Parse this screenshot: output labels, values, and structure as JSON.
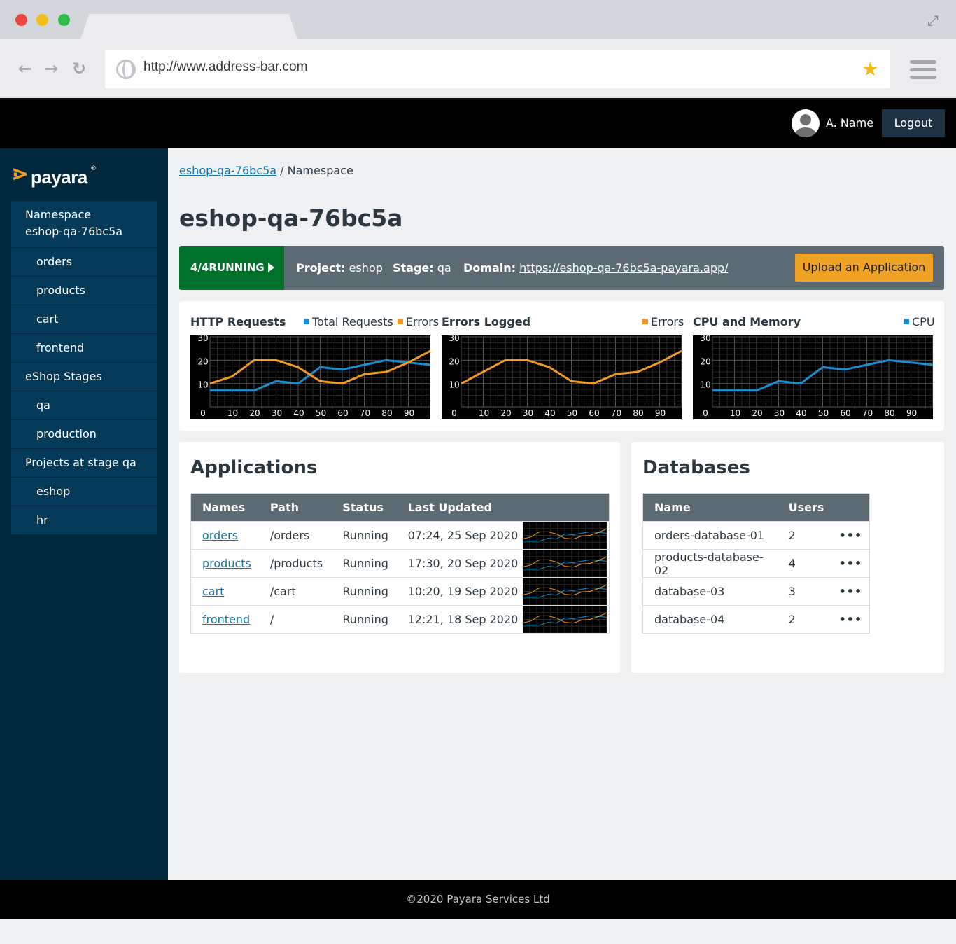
{
  "browser": {
    "url": "http://www.address-bar.com",
    "back_icon": "arrow-left-icon",
    "forward_icon": "arrow-right-icon",
    "reload_icon": "reload-icon",
    "bookmark_icon": "star-icon",
    "menu_icon": "hamburger-menu-icon"
  },
  "header": {
    "username": "A. Name",
    "logout_label": "Logout"
  },
  "brand": {
    "name": "payara",
    "registered": "®",
    "accent": "#f29a1e"
  },
  "sidebar": {
    "items": [
      {
        "label": "Namespace eshop-qa-76bc5a",
        "level": 0
      },
      {
        "label": "orders",
        "level": 1
      },
      {
        "label": "products",
        "level": 1
      },
      {
        "label": "cart",
        "level": 1
      },
      {
        "label": "frontend",
        "level": 1
      },
      {
        "label": "eShop Stages",
        "level": 0
      },
      {
        "label": "qa",
        "level": 1
      },
      {
        "label": "production",
        "level": 1
      },
      {
        "label": "Projects at stage qa",
        "level": 0
      },
      {
        "label": "eshop",
        "level": 1
      },
      {
        "label": "hr",
        "level": 1
      }
    ]
  },
  "breadcrumb": {
    "link": "eshop-qa-76bc5a",
    "separator": "/",
    "current": "Namespace"
  },
  "page_title": "eshop-qa-76bc5a",
  "status": {
    "running": "4/4RUNNING",
    "project_label": "Project:",
    "project": "eshop",
    "stage_label": "Stage:",
    "stage": "qa",
    "domain_label": "Domain:",
    "domain": "https://eshop-qa-76bc5a-payara.app/",
    "upload_label": "Upload an Application",
    "running_color": "#00712b",
    "upload_color": "#f0a225"
  },
  "chart_data": [
    {
      "type": "line",
      "title": "HTTP Requests",
      "x": [
        0,
        10,
        20,
        30,
        40,
        50,
        60,
        70,
        80,
        90,
        100
      ],
      "xticks": [
        "0",
        "10",
        "20",
        "30",
        "40",
        "50",
        "60",
        "70",
        "80",
        "90"
      ],
      "yticks": [
        "30",
        "20",
        "10"
      ],
      "ylim": [
        0,
        30
      ],
      "grid": true,
      "legend": "top-right",
      "series": [
        {
          "name": "Total Requests",
          "color": "#1a8fd0",
          "values": [
            7,
            7,
            7,
            11,
            10,
            17,
            16,
            18,
            20,
            19,
            18
          ]
        },
        {
          "name": "Errors",
          "color": "#f29a1e",
          "values": [
            10,
            13,
            20,
            20,
            17,
            11,
            10,
            14,
            15,
            19,
            24
          ]
        }
      ]
    },
    {
      "type": "line",
      "title": "Errors Logged",
      "x": [
        0,
        10,
        20,
        30,
        40,
        50,
        60,
        70,
        80,
        90,
        100
      ],
      "xticks": [
        "0",
        "10",
        "20",
        "30",
        "40",
        "50",
        "60",
        "70",
        "80",
        "90"
      ],
      "yticks": [
        "30",
        "20",
        "10"
      ],
      "ylim": [
        0,
        30
      ],
      "grid": true,
      "legend": "top-right",
      "series": [
        {
          "name": "Errors",
          "color": "#f29a1e",
          "values": [
            10,
            15,
            20,
            20,
            17,
            11,
            10,
            14,
            15,
            19,
            24
          ]
        }
      ]
    },
    {
      "type": "line",
      "title": "CPU and Memory",
      "x": [
        0,
        10,
        20,
        30,
        40,
        50,
        60,
        70,
        80,
        90,
        100
      ],
      "xticks": [
        "0",
        "10",
        "20",
        "30",
        "40",
        "50",
        "60",
        "70",
        "80",
        "90"
      ],
      "yticks": [
        "30",
        "20",
        "10"
      ],
      "ylim": [
        0,
        30
      ],
      "grid": true,
      "legend": "top-right",
      "series": [
        {
          "name": "CPU",
          "color": "#1a8fd0",
          "values": [
            7,
            7,
            7,
            11,
            10,
            17,
            16,
            18,
            20,
            19,
            18
          ]
        }
      ]
    }
  ],
  "applications": {
    "title": "Applications",
    "columns": [
      "Names",
      "Path",
      "Status",
      "Last Updated"
    ],
    "rows": [
      {
        "name": "orders",
        "path": "/orders",
        "status": "Running",
        "updated": "07:24, 25 Sep 2020"
      },
      {
        "name": "products",
        "path": "/products",
        "status": "Running",
        "updated": "17:30, 20 Sep 2020"
      },
      {
        "name": "cart",
        "path": "/cart",
        "status": "Running",
        "updated": "10:20, 19 Sep 2020"
      },
      {
        "name": "frontend",
        "path": "/",
        "status": "Running",
        "updated": "12:21, 18 Sep 2020"
      }
    ]
  },
  "databases": {
    "title": "Databases",
    "columns": [
      "Name",
      "Users"
    ],
    "rows": [
      {
        "name": "orders-database-01",
        "users": "2"
      },
      {
        "name": "products-database-02",
        "users": "4"
      },
      {
        "name": "database-03",
        "users": "3"
      },
      {
        "name": "database-04",
        "users": "2"
      }
    ],
    "row_menu": "•••"
  },
  "footer": {
    "text": "©2020 Payara Services Ltd"
  }
}
